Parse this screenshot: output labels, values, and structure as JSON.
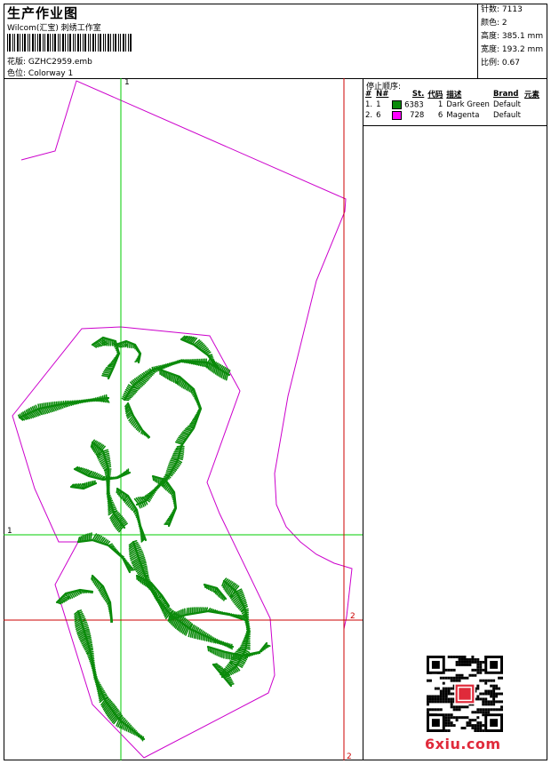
{
  "header": {
    "title": "生产作业图",
    "company": "Wilcom(汇宝) 刺绣工作室",
    "design_label": "花版:",
    "design_value": "GZHC2959.emb",
    "colorway_label": "色位:",
    "colorway_value": "Colorway 1"
  },
  "stats": [
    {
      "label": "针数:",
      "value": "7113"
    },
    {
      "label": "颜色:",
      "value": "2"
    },
    {
      "label": "高度:",
      "value": "385.1 mm"
    },
    {
      "label": "宽度:",
      "value": "193.2 mm"
    },
    {
      "label": "比例:",
      "value": "0.67"
    }
  ],
  "stop_sequence": {
    "title": "停止顺序:",
    "columns": [
      "#",
      "N#",
      "St.",
      "代码",
      "描述",
      "Brand",
      "元素"
    ],
    "rows": [
      {
        "num": "1.",
        "n": "1",
        "color": "#0a8a0a",
        "st": "6383",
        "code": "1",
        "desc": "Dark Green",
        "brand": "Default"
      },
      {
        "num": "2.",
        "n": "6",
        "color": "#ff00ff",
        "st": "728",
        "code": "6",
        "desc": "Magenta",
        "brand": "Default"
      }
    ]
  },
  "guides": {
    "green_v": "1",
    "green_h": "1",
    "red_v": "2",
    "red_h": "2"
  },
  "colors": {
    "outline": "#cc00cc",
    "stitch": "#0a8a0a",
    "guide_green": "#00cc00",
    "guide_red": "#cc0000"
  },
  "watermark": "6xiu.com"
}
